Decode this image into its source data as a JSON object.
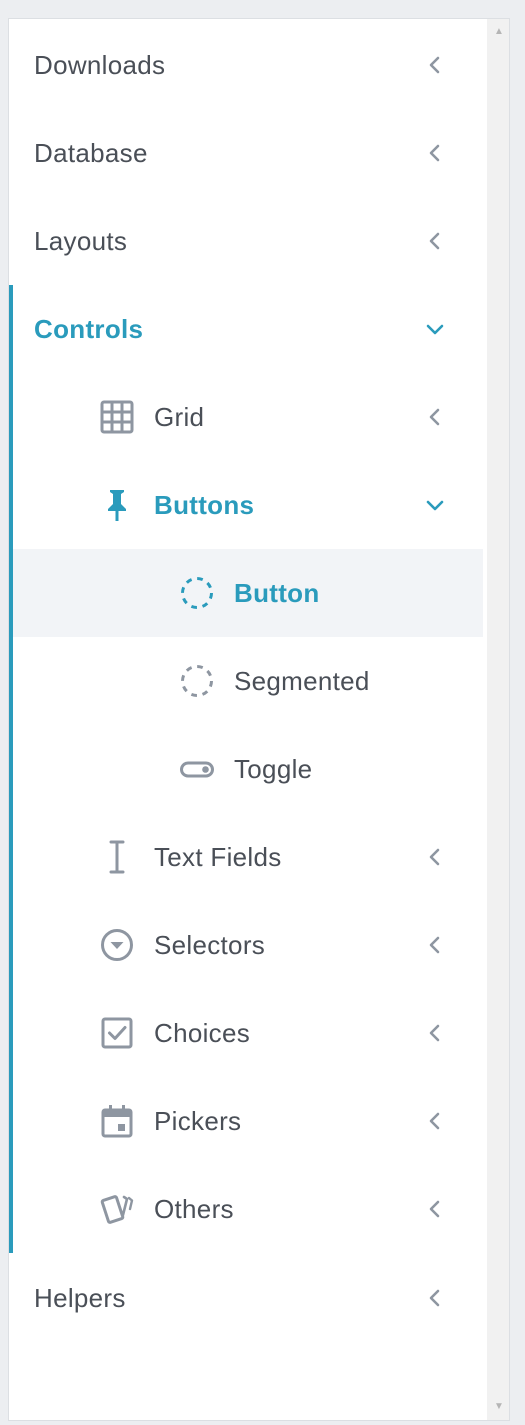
{
  "colors": {
    "accent": "#2a9bbc",
    "text": "#4a4f57",
    "icon": "#8e96a1",
    "selected_bg": "#f2f4f7"
  },
  "menu": {
    "downloads": {
      "label": "Downloads",
      "icon": "chevron-left-icon"
    },
    "database": {
      "label": "Database",
      "icon": "chevron-left-icon"
    },
    "layouts": {
      "label": "Layouts",
      "icon": "chevron-left-icon"
    },
    "controls": {
      "label": "Controls",
      "expanded": true,
      "children": {
        "grid": {
          "label": "Grid",
          "icon": "grid-icon"
        },
        "buttons": {
          "label": "Buttons",
          "icon": "pin-icon",
          "expanded": true,
          "children": {
            "button": {
              "label": "Button",
              "icon": "dashed-circle-icon",
              "selected": true
            },
            "segmented": {
              "label": "Segmented",
              "icon": "dashed-circle-icon"
            },
            "toggle": {
              "label": "Toggle",
              "icon": "toggle-icon"
            }
          }
        },
        "text_fields": {
          "label": "Text Fields",
          "icon": "text-cursor-icon"
        },
        "selectors": {
          "label": "Selectors",
          "icon": "dropdown-circle-icon"
        },
        "choices": {
          "label": "Choices",
          "icon": "checkbox-icon"
        },
        "pickers": {
          "label": "Pickers",
          "icon": "calendar-icon"
        },
        "others": {
          "label": "Others",
          "icon": "cards-icon"
        }
      }
    },
    "helpers": {
      "label": "Helpers",
      "icon": "chevron-left-icon"
    }
  }
}
